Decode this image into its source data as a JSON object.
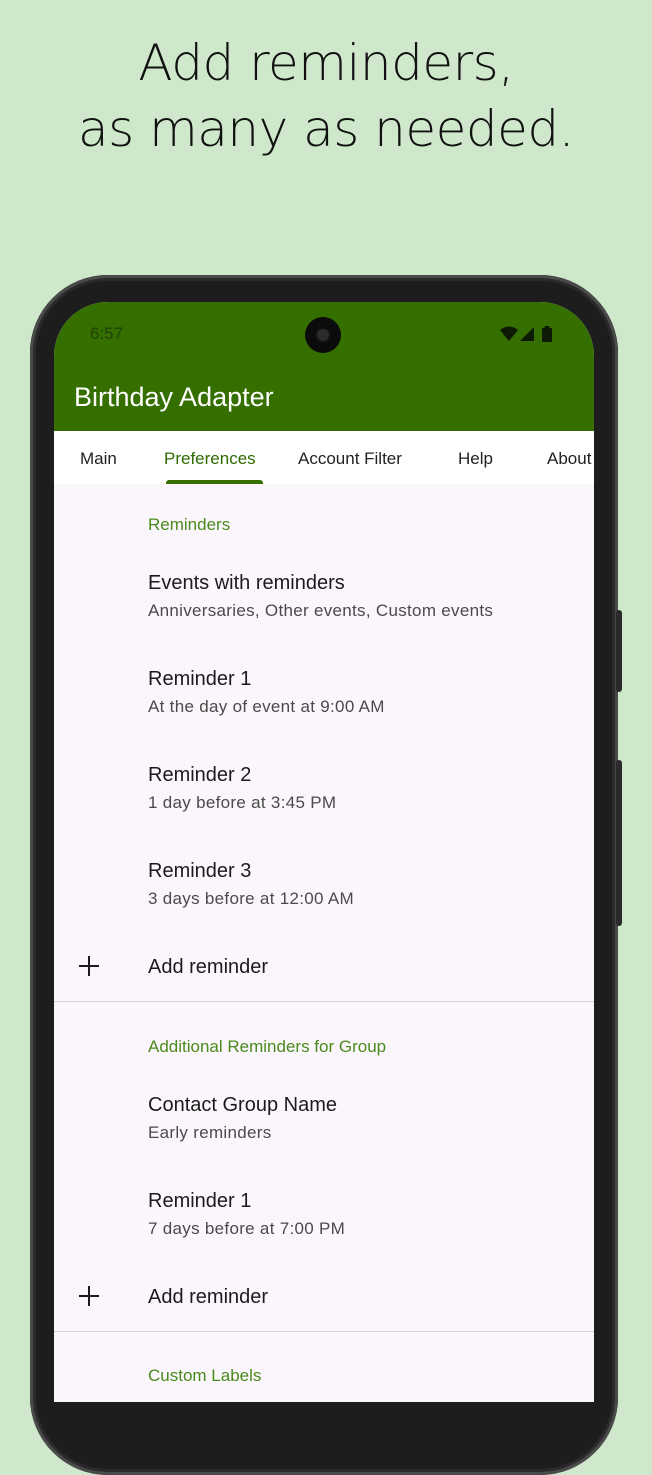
{
  "headline": {
    "line1": "Add reminders,",
    "line2": "as many as needed."
  },
  "status_bar": {
    "time": "6:57"
  },
  "app": {
    "title": "Birthday Adapter"
  },
  "tabs": [
    {
      "label": "Main"
    },
    {
      "label": "Preferences",
      "active": true
    },
    {
      "label": "Account Filter"
    },
    {
      "label": "Help"
    },
    {
      "label": "About"
    }
  ],
  "sections": [
    {
      "title": "Reminders",
      "items": [
        {
          "title": "Events with reminders",
          "subtitle": "Anniversaries, Other events, Custom events"
        },
        {
          "title": "Reminder 1",
          "subtitle": "At the day of event at 9:00 AM"
        },
        {
          "title": "Reminder 2",
          "subtitle": "1 day before at 3:45 PM"
        },
        {
          "title": "Reminder 3",
          "subtitle": "3 days before at 12:00 AM"
        }
      ],
      "add_label": "Add reminder"
    },
    {
      "title": "Additional Reminders for Group",
      "items": [
        {
          "title": "Contact Group Name",
          "subtitle": "Early reminders"
        },
        {
          "title": "Reminder 1",
          "subtitle": "7 days before at 7:00 PM"
        }
      ],
      "add_label": "Add reminder"
    },
    {
      "title": "Custom Labels"
    }
  ],
  "colors": {
    "background": "#cfe8cb",
    "app_bar": "#346f00",
    "accent": "#4a8a1c",
    "surface": "#fbf6fc"
  },
  "icons": [
    "camera-icon",
    "wifi-icon",
    "signal-icon",
    "battery-icon",
    "plus-icon"
  ]
}
